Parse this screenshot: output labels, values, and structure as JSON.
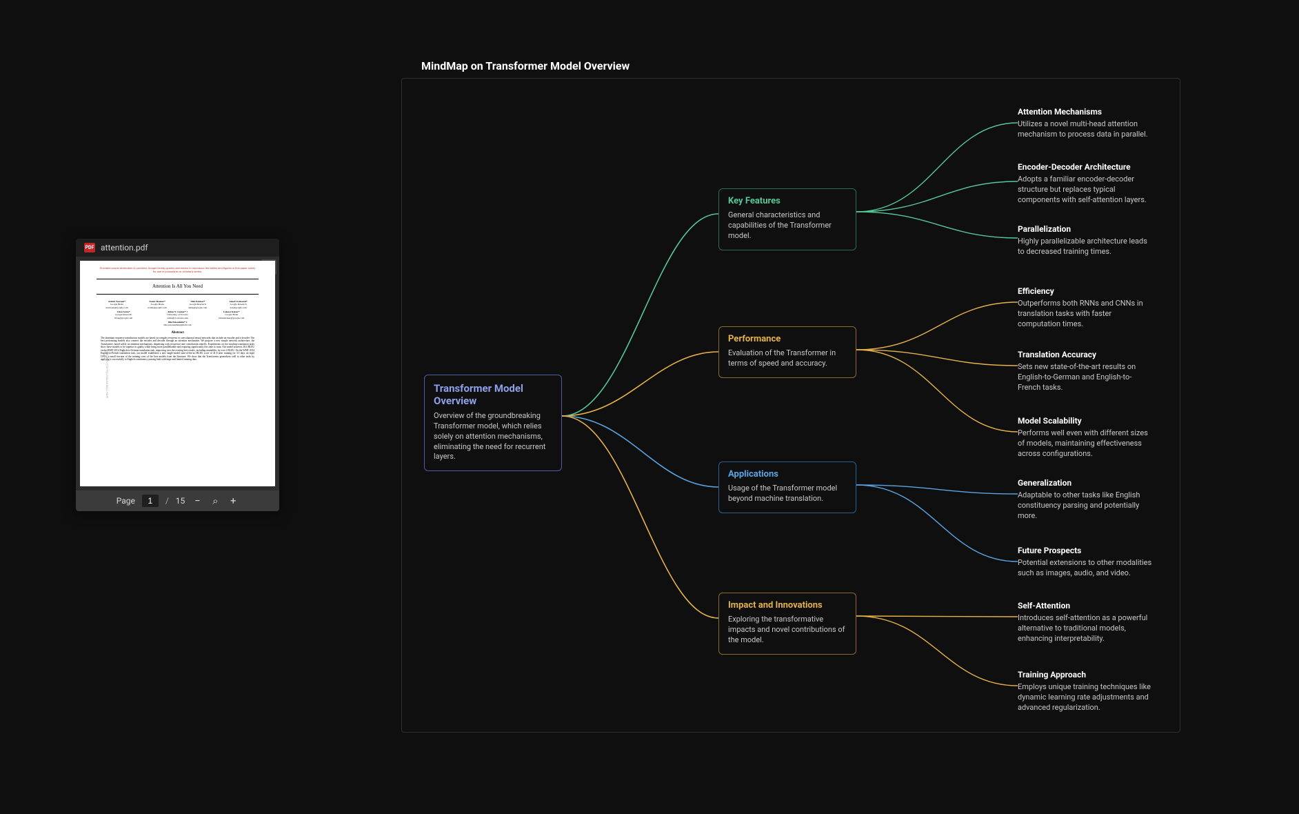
{
  "page_title": "MindMap on Transformer Model Overview",
  "pdf": {
    "filename": "attention.pdf",
    "page_label": "Page",
    "current_page": "1",
    "total_pages": "15",
    "permission_notice": "Provided proper attribution is provided, Google hereby grants permission to reproduce the tables and figures in this paper solely for use in journalistic or scholarly works.",
    "paper_title": "Attention Is All You Need",
    "side_label": "arXiv:1706.03762v7  [cs.CL]  2 Aug 2023",
    "authors_row1": [
      {
        "name": "Ashish Vaswani*",
        "affil": "Google Brain",
        "email": "avaswani@google.com"
      },
      {
        "name": "Noam Shazeer*",
        "affil": "Google Brain",
        "email": "noam@google.com"
      },
      {
        "name": "Niki Parmar*",
        "affil": "Google Research",
        "email": "nikip@google.com"
      },
      {
        "name": "Jakob Uszkoreit*",
        "affil": "Google Research",
        "email": "usz@google.com"
      }
    ],
    "authors_row2": [
      {
        "name": "Llion Jones*",
        "affil": "Google Research",
        "email": "llion@google.com"
      },
      {
        "name": "Aidan N. Gomez* †",
        "affil": "University of Toronto",
        "email": "aidan@cs.toronto.edu"
      },
      {
        "name": "Łukasz Kaiser*",
        "affil": "Google Brain",
        "email": "lukaszkaiser@google.com"
      }
    ],
    "authors_row3": [
      {
        "name": "Illia Polosukhin* ‡",
        "affil": "",
        "email": "illia.polosukhin@gmail.com"
      }
    ],
    "abstract_heading": "Abstract",
    "abstract": "The dominant sequence transduction models are based on complex recurrent or convolutional neural networks that include an encoder and a decoder. The best performing models also connect the encoder and decoder through an attention mechanism. We propose a new simple network architecture, the Transformer, based solely on attention mechanisms, dispensing with recurrence and convolutions entirely. Experiments on two machine translation tasks show these models to be superior in quality while being more parallelizable and requiring significantly less time to train. Our model achieves 28.4 BLEU on the WMT 2014 English-to-German translation task, improving over the existing best results, including ensembles, by over 2 BLEU. On the WMT 2014 English-to-French translation task, our model establishes a new single-model state-of-the-art BLEU score of 41.8 after training for 3.5 days on eight GPUs, a small fraction of the training costs of the best models from the literature. We show that the Transformer generalizes well to other tasks by applying it successfully to English constituency parsing both with large and limited training data."
  },
  "root": {
    "title": "Transformer Model Overview",
    "desc": "Overview of the groundbreaking Transformer model, which relies solely on attention mechanisms, eliminating the need for recurrent layers."
  },
  "branches": [
    {
      "id": "key",
      "title": "Key Features",
      "desc": "General characteristics and capabilities of the Transformer model.",
      "color": "#57c79a",
      "leaves": [
        {
          "title": "Attention Mechanisms",
          "desc": "Utilizes a novel multi-head attention mechanism to process data in parallel."
        },
        {
          "title": "Encoder-Decoder Architecture",
          "desc": "Adopts a familiar encoder-decoder structure but replaces typical components with self-attention layers."
        },
        {
          "title": "Parallelization",
          "desc": "Highly parallelizable architecture leads to decreased training times."
        }
      ]
    },
    {
      "id": "perf",
      "title": "Performance",
      "desc": "Evaluation of the Transformer in terms of speed and accuracy.",
      "color": "#e6b24a",
      "leaves": [
        {
          "title": "Efficiency",
          "desc": "Outperforms both RNNs and CNNs in translation tasks with faster computation times."
        },
        {
          "title": "Translation Accuracy",
          "desc": "Sets new state-of-the-art results on English-to-German and English-to-French tasks."
        },
        {
          "title": "Model Scalability",
          "desc": "Performs well even with different sizes of models, maintaining effectiveness across configurations."
        }
      ]
    },
    {
      "id": "apps",
      "title": "Applications",
      "desc": "Usage of the Transformer model beyond machine translation.",
      "color": "#5aa5e6",
      "leaves": [
        {
          "title": "Generalization",
          "desc": "Adaptable to other tasks like English constituency parsing and potentially more."
        },
        {
          "title": "Future Prospects",
          "desc": "Potential extensions to other modalities such as images, audio, and video."
        }
      ]
    },
    {
      "id": "impact",
      "title": "Impact and Innovations",
      "desc": "Exploring the transformative impacts and novel contributions of the model.",
      "color": "#e6b24a",
      "leaves": [
        {
          "title": "Self-Attention",
          "desc": "Introduces self-attention as a powerful alternative to traditional models, enhancing interpretability."
        },
        {
          "title": "Training Approach",
          "desc": "Employs unique training techniques like dynamic learning rate adjustments and advanced regularization."
        }
      ]
    }
  ],
  "icons": {
    "zoom_out": "−",
    "zoom_in": "+",
    "search": "⌕"
  }
}
